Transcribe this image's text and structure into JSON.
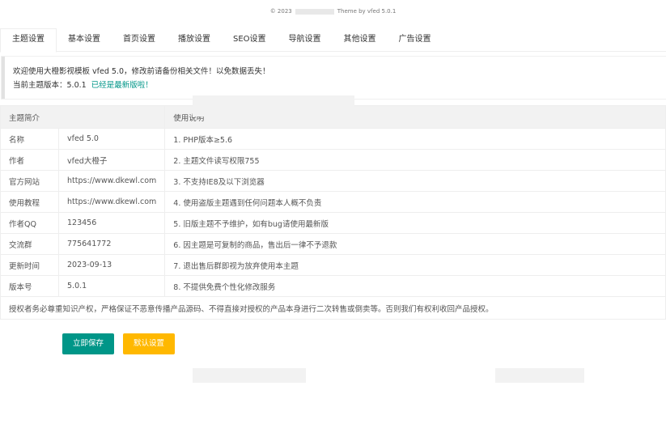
{
  "footer_top": {
    "copyright_prefix": "© 2023",
    "copyright_suffix": "Theme by vfed 5.0.1"
  },
  "tabs": [
    {
      "label": "主题设置",
      "active": true
    },
    {
      "label": "基本设置"
    },
    {
      "label": "首页设置"
    },
    {
      "label": "播放设置"
    },
    {
      "label": "SEO设置"
    },
    {
      "label": "导航设置"
    },
    {
      "label": "其他设置"
    },
    {
      "label": "广告设置"
    }
  ],
  "notice": {
    "line1": "欢迎使用大橙影视模板 vfed 5.0，修改前请备份相关文件！以免数据丢失！",
    "line2_label": "当前主题版本：5.0.1",
    "line2_status": "已经是最新版啦！"
  },
  "table": {
    "headers": [
      "主题简介",
      "使用说明"
    ],
    "rows": [
      [
        "名称",
        "vfed 5.0",
        "1. PHP版本≥5.6"
      ],
      [
        "作者",
        "vfed大橙子",
        "2. 主题文件读写权限755"
      ],
      [
        "官方网站",
        "https://www.dkewl.com",
        "3. 不支持IE8及以下浏览器"
      ],
      [
        "使用教程",
        "https://www.dkewl.com",
        "4. 使用盗版主题遇到任何问题本人概不负责"
      ],
      [
        "作者QQ",
        "123456",
        "5. 旧版主题不予维护，如有bug请使用最新版"
      ],
      [
        "交流群",
        "775641772",
        "6. 因主题是可复制的商品，售出后一律不予退款"
      ],
      [
        "更新时间",
        "2023-09-13",
        "7. 退出售后群即视为放弃使用本主题"
      ],
      [
        "版本号",
        "5.0.1",
        "8. 不提供免费个性化修改服务"
      ]
    ],
    "footer": "授权者务必尊重知识产权，严格保证不恶意传播产品源码、不得直接对授权的产品本身进行二次转售或倒卖等。否则我们有权利收回产品授权。"
  },
  "buttons": {
    "save": "立即保存",
    "default": "默认设置"
  },
  "colors": {
    "primary": "#009688",
    "warning": "#FFB800"
  }
}
